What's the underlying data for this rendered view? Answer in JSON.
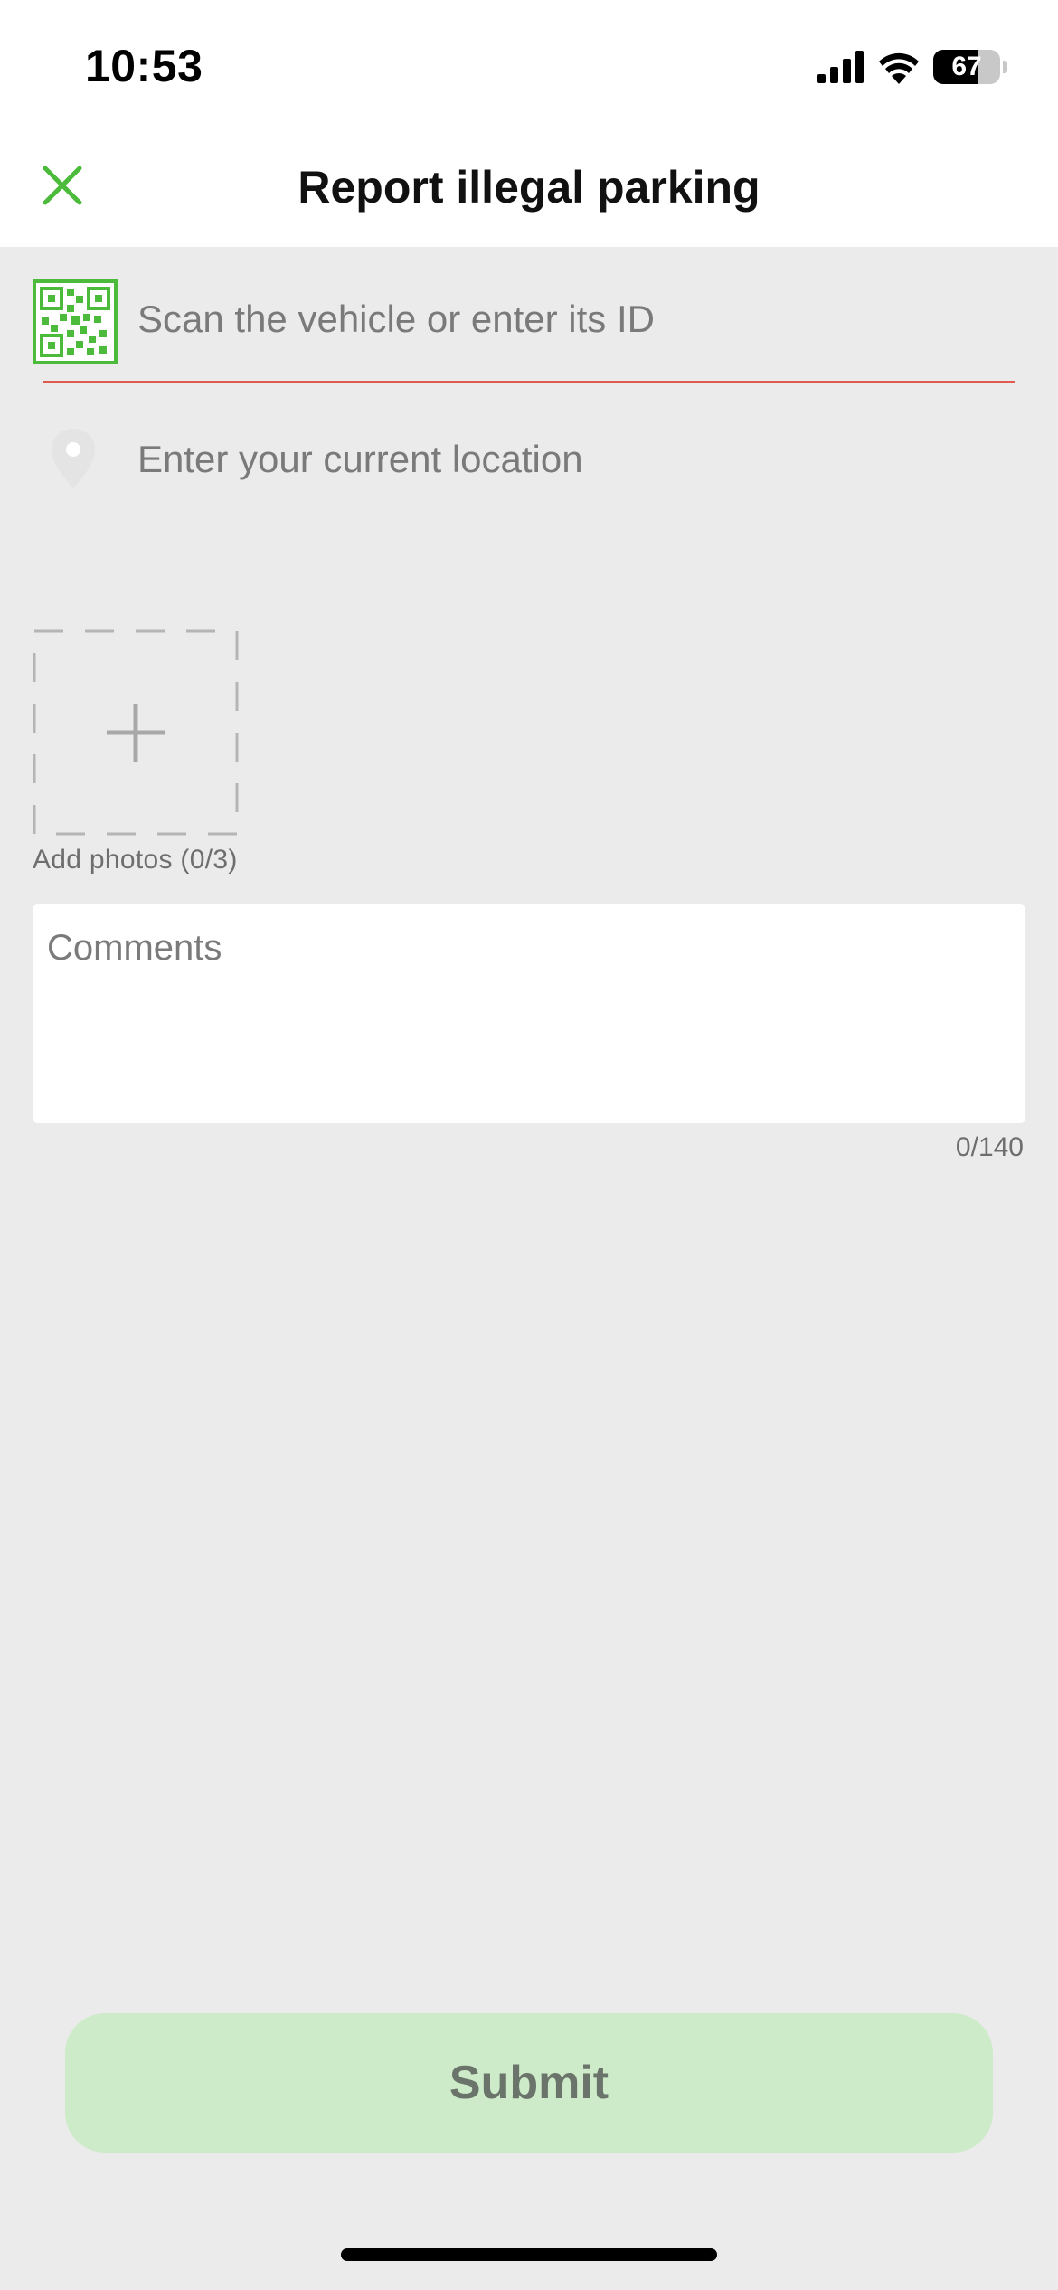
{
  "status_bar": {
    "time": "10:53",
    "battery_level": "67",
    "battery_fraction": 0.67,
    "icons": [
      "cellular-signal-icon",
      "wifi-icon",
      "battery-icon"
    ]
  },
  "header": {
    "title": "Report illegal parking",
    "close_icon": "close-icon"
  },
  "form": {
    "vehicle_id": {
      "placeholder": "Scan the vehicle or enter its ID",
      "value": "",
      "icon": "qr-code-icon"
    },
    "location": {
      "placeholder": "Enter your current location",
      "value": "",
      "icon": "location-pin-icon"
    },
    "photos": {
      "caption": "Add photos (0/3)",
      "count": 0,
      "max": 3,
      "icon": "plus-icon"
    },
    "comments": {
      "placeholder": "Comments",
      "value": "",
      "counter": "0/140"
    },
    "submit_label": "Submit"
  },
  "colors": {
    "accent_green": "#4cbb3c",
    "underline_red": "#e05a4e",
    "submit_bg": "#cdebc8",
    "page_bg": "#ebebeb"
  }
}
